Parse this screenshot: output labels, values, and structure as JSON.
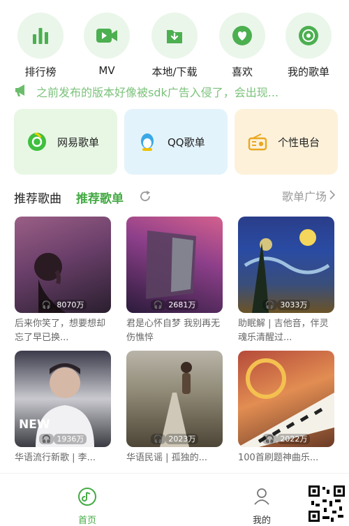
{
  "quick_nav": [
    {
      "label": "排行榜",
      "icon": "chart-bars-icon"
    },
    {
      "label": "MV",
      "icon": "video-camera-icon"
    },
    {
      "label": "本地/下载",
      "icon": "download-folder-icon"
    },
    {
      "label": "喜欢",
      "icon": "heart-icon"
    },
    {
      "label": "我的歌单",
      "icon": "music-disc-icon"
    }
  ],
  "notice": {
    "icon": "megaphone-icon",
    "text": "之前发布的版本好像被sdk广告入侵了，会出现..."
  },
  "cards": [
    {
      "label": "网易歌单",
      "icon": "netease-icon",
      "bg": "#e8f7e4"
    },
    {
      "label": "QQ歌单",
      "icon": "qq-penguin-icon",
      "bg": "#e3f3fb"
    },
    {
      "label": "个性电台",
      "icon": "radio-icon",
      "bg": "#fdf1da"
    }
  ],
  "section": {
    "tab_songs": "推荐歌曲",
    "tab_playlists": "推荐歌单",
    "more": "歌单广场"
  },
  "tiles": [
    {
      "plays": "8070万",
      "title": "后来你笑了，想要想却忘了早已换..."
    },
    {
      "plays": "2681万",
      "title": "君是心怀自梦 我别再无伤憔悴"
    },
    {
      "plays": "3033万",
      "title": "助眠解 | 吉他音，伴灵魂乐清醒过..."
    },
    {
      "plays": "1936万",
      "title": "华语流行新歌 | 李..."
    },
    {
      "plays": "2023万",
      "title": "华语民谣 | 孤独的..."
    },
    {
      "plays": "2022万",
      "title": "100首刷题神曲乐..."
    }
  ],
  "tile4_badge": "NEW",
  "bottom_nav": [
    {
      "label": "首页",
      "icon": "home-music-icon",
      "active": true
    },
    {
      "label": "我的",
      "icon": "user-icon",
      "active": false
    }
  ],
  "colors": {
    "accent": "#44aa44",
    "notice": "#7bc27b",
    "muted": "#999999"
  }
}
